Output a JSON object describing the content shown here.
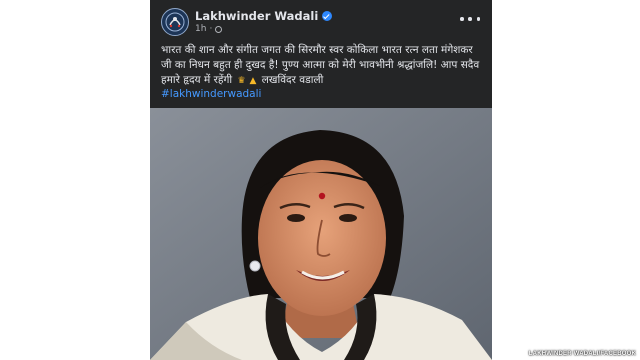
{
  "post": {
    "author": "Lakhwinder Wadali",
    "time": "1h",
    "caption_lines": [
      "भारत की शान और संगीत जगत की सिरमौर स्वर कोकिला भारत रत्न लता मंगेशकर",
      "जी का निधन बहुत ही दुखद है! पुण्य आत्मा को मेरी भावभीनी श्रद्धांजलि! आप सदैव",
      "हमारे हृदय में रहेंगी"
    ],
    "caption_signature": "लखविंदर वडाली",
    "hashtag": "#lakhwinderwadali"
  },
  "photo_credit": "LAKHWINDER WADALI/FACEBOOK",
  "icons": {
    "verified": "verified-badge-icon",
    "privacy": "globe-icon",
    "more": "more-options-icon",
    "emojis": [
      "crown-emoji",
      "praying-hands-emoji"
    ]
  },
  "colors": {
    "card_background": "#242526",
    "text": "#e4e6eb",
    "secondary_text": "#b0b3b8",
    "link": "#4599ff",
    "verified": "#2d88ff"
  }
}
